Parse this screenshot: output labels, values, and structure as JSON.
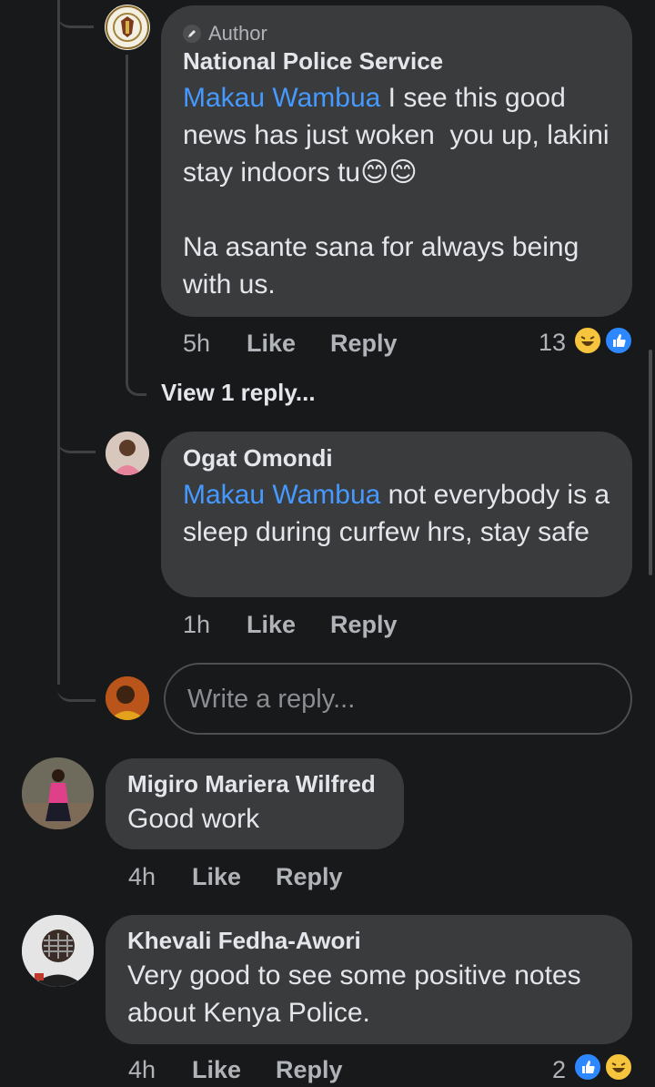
{
  "author_comment": {
    "badge": "Author",
    "name": "National Police Service",
    "mention": "Makau Wambua",
    "text": " I see this good news has just woken  you up, lakini stay indoors tu😊😊\n\nNa asante sana for always being with us.",
    "time": "5h",
    "like": "Like",
    "reply": "Reply",
    "reaction_count": "13"
  },
  "view_replies": "View 1 reply...",
  "ogat_comment": {
    "name": "Ogat Omondi",
    "mention": "Makau Wambua",
    "text": " not everybody is a sleep during curfew hrs, stay safe",
    "time": "1h",
    "like": "Like",
    "reply": "Reply"
  },
  "reply_input": {
    "placeholder": "Write a reply..."
  },
  "migiro_comment": {
    "name": "Migiro Mariera Wilfred",
    "text": "Good work",
    "time": "4h",
    "like": "Like",
    "reply": "Reply"
  },
  "khevali_comment": {
    "name": "Khevali Fedha-Awori",
    "text": "Very good to see some positive notes about Kenya Police.",
    "time": "4h",
    "like": "Like",
    "reply": "Reply",
    "reaction_count": "2"
  },
  "colors": {
    "background": "#18191a",
    "bubble": "#3a3b3c",
    "mention": "#4599ff",
    "secondary_text": "#b0b3b8",
    "like_reaction": "#2d88ff",
    "haha_reaction": "#f7c43d"
  }
}
